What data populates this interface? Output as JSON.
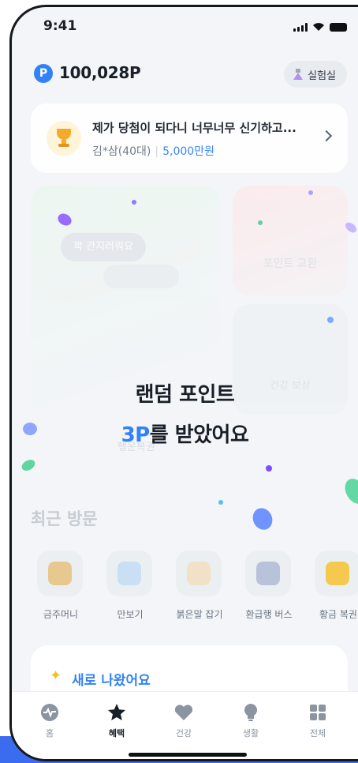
{
  "status": {
    "time": "9:41"
  },
  "header": {
    "points": "100,028P",
    "point_badge": "P",
    "lab_label": "실험실"
  },
  "winner": {
    "title": "제가 당첨이 되다니 너무너무 신기하고...",
    "user": "김*삼(40대)",
    "amount": "5,000만원"
  },
  "background_cards": {
    "tag": "꽉 간지러워요",
    "exchange_label": "포인트 교환",
    "health_label": "건강 보상",
    "lotto_label": "행운복권"
  },
  "overlay": {
    "line1": "랜덤 포인트",
    "highlight": "3P",
    "line2_rest": "를 받았어요"
  },
  "recent": {
    "title": "최근 방문",
    "items": [
      {
        "label": "금주머니",
        "icon": "money-bag-icon",
        "color": "#e7c98f"
      },
      {
        "label": "만보기",
        "icon": "shoe-icon",
        "color": "#c9dff3"
      },
      {
        "label": "붉은말 잡기",
        "icon": "horse-icon",
        "color": "#f1e2c7"
      },
      {
        "label": "환급행 버스",
        "icon": "bus-icon",
        "color": "#b8c2d8"
      },
      {
        "label": "황금 복권",
        "icon": "lottery-ticket-icon",
        "color": "#f5c84f"
      }
    ]
  },
  "new_section": {
    "title": "새로 나왔어요"
  },
  "tabs": [
    {
      "label": "홈",
      "icon": "home-pulse-icon",
      "active": false
    },
    {
      "label": "혜택",
      "icon": "star-icon",
      "active": true
    },
    {
      "label": "건강",
      "icon": "heart-icon",
      "active": false
    },
    {
      "label": "생활",
      "icon": "lightbulb-icon",
      "active": false
    },
    {
      "label": "전체",
      "icon": "grid-icon",
      "active": false
    }
  ],
  "colors": {
    "accent": "#3182f6",
    "text": "#191f28",
    "muted": "#6b7684",
    "bottom_band": "#3b6cf0"
  }
}
